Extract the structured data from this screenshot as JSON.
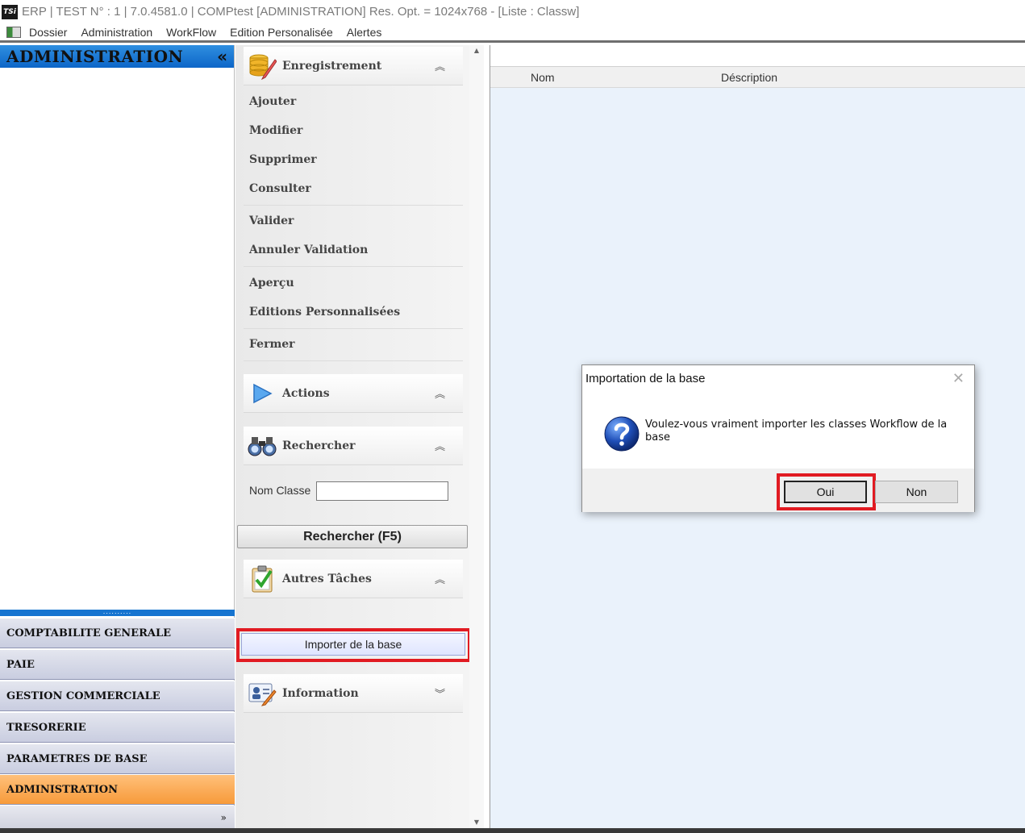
{
  "window": {
    "logo_text": "TSi",
    "title": "ERP | TEST N° : 1 | 7.0.4581.0 | COMPtest [ADMINISTRATION] Res. Opt. = 1024x768 - [Liste : Classw]"
  },
  "menu": {
    "items": [
      "Dossier",
      "Administration",
      "WorkFlow",
      "Edition Personalisée",
      "Alertes"
    ]
  },
  "sidebar": {
    "title": "ADMINISTRATION",
    "collapse_glyph": "«",
    "splitter_glyph": "..........",
    "modules": [
      {
        "label": "COMPTABILITE GENERALE",
        "active": false
      },
      {
        "label": "PAIE",
        "active": false
      },
      {
        "label": "GESTION COMMERCIALE",
        "active": false
      },
      {
        "label": "TRESORERIE",
        "active": false
      },
      {
        "label": "PARAMETRES DE BASE",
        "active": false
      },
      {
        "label": "ADMINISTRATION",
        "active": true
      }
    ],
    "more_glyph": "»"
  },
  "taskpanel": {
    "groups": {
      "enregistrement": {
        "title": "Enregistrement",
        "chevron": "︽"
      },
      "actions": {
        "title": "Actions",
        "chevron": "︽"
      },
      "rechercher": {
        "title": "Rechercher",
        "chevron": "︽"
      },
      "autres": {
        "title": "Autres Tâches",
        "chevron": "︽"
      },
      "information": {
        "title": "Information",
        "chevron": "︾"
      }
    },
    "items": {
      "ajouter": "Ajouter",
      "modifier": "Modifier",
      "supprimer": "Supprimer",
      "consulter": "Consulter",
      "valider": "Valider",
      "annuler_validation": "Annuler Validation",
      "apercu": "Aperçu",
      "editions": "Editions Personnalisées",
      "fermer": "Fermer"
    },
    "search": {
      "label": "Nom Classe",
      "value": "",
      "button": "Rechercher (F5)"
    },
    "import_button": "Importer de la base",
    "scroll_up": "▲",
    "scroll_down": "▼"
  },
  "list": {
    "columns": [
      "Nom",
      "Déscription"
    ]
  },
  "dialog": {
    "title": "Importation de la base",
    "close": "✕",
    "message": "Voulez-vous vraiment importer les classes Workflow de la base",
    "yes": "Oui",
    "no": "Non"
  },
  "colors": {
    "sidebar_header": "#0d66c8",
    "active_module": "#f79a3a",
    "highlight": "#e11b22"
  }
}
